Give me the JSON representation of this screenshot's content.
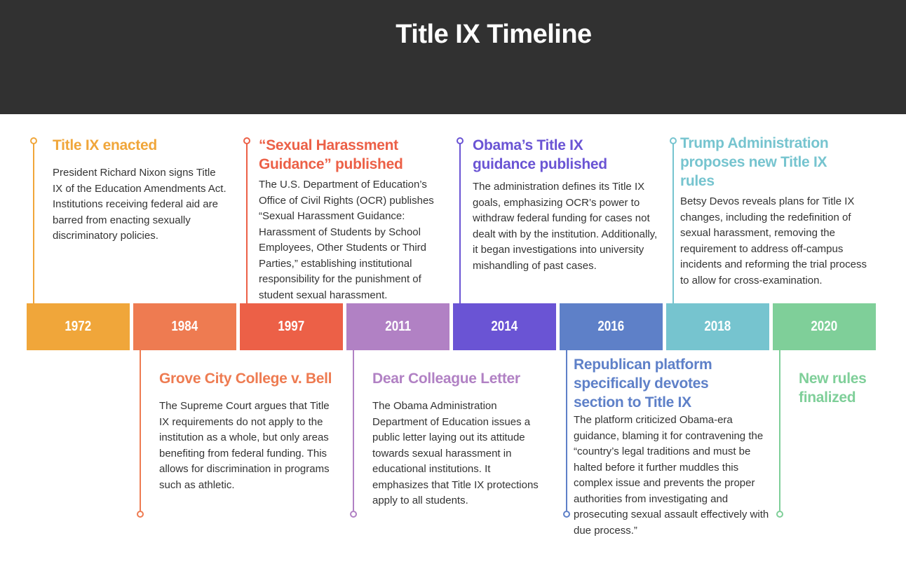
{
  "title": "Title IX Timeline",
  "colors": {
    "header_bg": "#313131",
    "c1972": "#F0A63A",
    "c1984": "#EE7B51",
    "c1997": "#EC6047",
    "c2011": "#B181C4",
    "c2014": "#6A54D4",
    "c2016": "#5E80C8",
    "c2018": "#76C4CF",
    "c2020": "#7FCF99"
  },
  "years": [
    "1972",
    "1984",
    "1997",
    "2011",
    "2014",
    "2016",
    "2018",
    "2020"
  ],
  "events": [
    {
      "year": "1972",
      "title": "Title IX enacted",
      "description": "President Richard Nixon signs Title IX of the Education Amendments Act. Institutions receiving federal aid are barred from enacting sexually discriminatory policies."
    },
    {
      "year": "1984",
      "title": "Grove City College v. Bell",
      "description": "The Supreme Court argues that Title IX requirements do not apply to the institution as a whole, but only areas benefiting from federal funding. This allows for discrimination in programs such as athletic."
    },
    {
      "year": "1997",
      "title": "“Sexual Harassment Guidance” published",
      "description": "The U.S. Department of Education’s Office of Civil Rights (OCR) publishes “Sexual Harassment Guidance: Harassment of Students by School Employees, Other Students or Third Parties,” establishing institutional responsibility for the punishment of student sexual harassment."
    },
    {
      "year": "2011",
      "title": "Dear Colleague Letter",
      "description": "The Obama Administration Department of Education issues a public letter laying out its attitude towards sexual harassment in educational institutions. It emphasizes that Title IX protections apply to all students."
    },
    {
      "year": "2014",
      "title": "Obama’s Title IX guidance published",
      "description": "The administration defines its Title IX goals, emphasizing OCR’s power to withdraw federal funding for cases not dealt with by the institution. Additionally, it began investigations into university mishandling of past cases."
    },
    {
      "year": "2016",
      "title": "Republican platform specifically devotes section to Title IX",
      "description": "The platform criticized Obama-era guidance, blaming it for contravening the “country’s legal traditions and must be halted before it further muddles this complex issue and prevents the proper authorities from investigating and prosecuting sexual assault effectively with due process.”"
    },
    {
      "year": "2018",
      "title": "Trump Administration proposes new Title IX rules",
      "description": "Betsy Devos reveals plans for Title IX changes, including the redefinition of sexual harassment, removing the requirement to address off-campus incidents and reforming the trial process to allow for cross-examination."
    },
    {
      "year": "2020",
      "title": "New rules finalized",
      "description": ""
    }
  ]
}
